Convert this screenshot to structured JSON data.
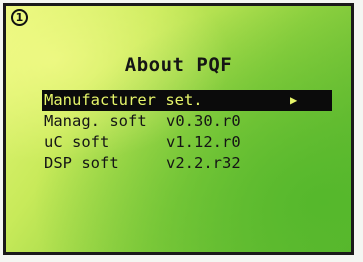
{
  "step_badge": "1",
  "screen": {
    "title": "About PQF",
    "menu": [
      {
        "label": "Manufacturer set.",
        "value": "",
        "selected": true,
        "arrow": "▶"
      },
      {
        "label": "Manag. soft",
        "value": "v0.30.r0",
        "selected": false
      },
      {
        "label": "uC soft",
        "value": "v1.12.r0",
        "selected": false
      },
      {
        "label": "DSP soft",
        "value": "v2.2.r32",
        "selected": false
      }
    ]
  },
  "colors": {
    "lcd_highlight": "#e8f77b",
    "lcd_base": "#5cb42e",
    "text": "#151515",
    "selection_bg": "#0b0b0b",
    "selection_text": "#e6f56a"
  }
}
